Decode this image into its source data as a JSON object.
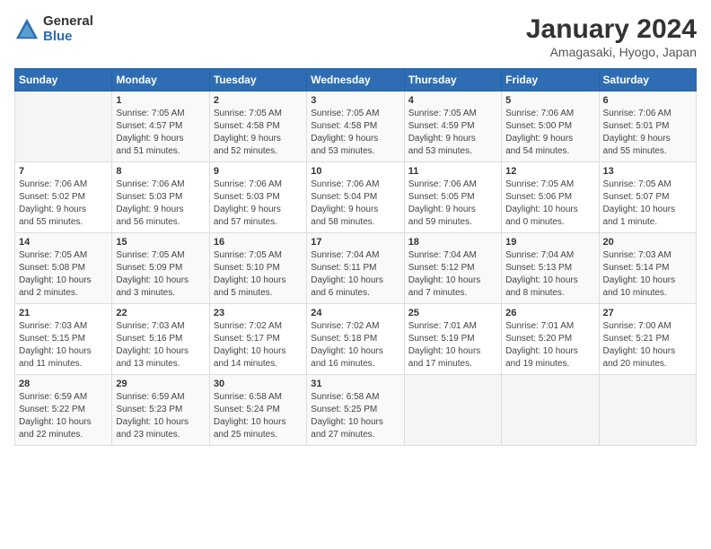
{
  "logo": {
    "general": "General",
    "blue": "Blue"
  },
  "header": {
    "title": "January 2024",
    "subtitle": "Amagasaki, Hyogo, Japan"
  },
  "columns": [
    "Sunday",
    "Monday",
    "Tuesday",
    "Wednesday",
    "Thursday",
    "Friday",
    "Saturday"
  ],
  "weeks": [
    [
      {
        "day": "",
        "info": ""
      },
      {
        "day": "1",
        "info": "Sunrise: 7:05 AM\nSunset: 4:57 PM\nDaylight: 9 hours\nand 51 minutes."
      },
      {
        "day": "2",
        "info": "Sunrise: 7:05 AM\nSunset: 4:58 PM\nDaylight: 9 hours\nand 52 minutes."
      },
      {
        "day": "3",
        "info": "Sunrise: 7:05 AM\nSunset: 4:58 PM\nDaylight: 9 hours\nand 53 minutes."
      },
      {
        "day": "4",
        "info": "Sunrise: 7:05 AM\nSunset: 4:59 PM\nDaylight: 9 hours\nand 53 minutes."
      },
      {
        "day": "5",
        "info": "Sunrise: 7:06 AM\nSunset: 5:00 PM\nDaylight: 9 hours\nand 54 minutes."
      },
      {
        "day": "6",
        "info": "Sunrise: 7:06 AM\nSunset: 5:01 PM\nDaylight: 9 hours\nand 55 minutes."
      }
    ],
    [
      {
        "day": "7",
        "info": "Sunrise: 7:06 AM\nSunset: 5:02 PM\nDaylight: 9 hours\nand 55 minutes."
      },
      {
        "day": "8",
        "info": "Sunrise: 7:06 AM\nSunset: 5:03 PM\nDaylight: 9 hours\nand 56 minutes."
      },
      {
        "day": "9",
        "info": "Sunrise: 7:06 AM\nSunset: 5:03 PM\nDaylight: 9 hours\nand 57 minutes."
      },
      {
        "day": "10",
        "info": "Sunrise: 7:06 AM\nSunset: 5:04 PM\nDaylight: 9 hours\nand 58 minutes."
      },
      {
        "day": "11",
        "info": "Sunrise: 7:06 AM\nSunset: 5:05 PM\nDaylight: 9 hours\nand 59 minutes."
      },
      {
        "day": "12",
        "info": "Sunrise: 7:05 AM\nSunset: 5:06 PM\nDaylight: 10 hours\nand 0 minutes."
      },
      {
        "day": "13",
        "info": "Sunrise: 7:05 AM\nSunset: 5:07 PM\nDaylight: 10 hours\nand 1 minute."
      }
    ],
    [
      {
        "day": "14",
        "info": "Sunrise: 7:05 AM\nSunset: 5:08 PM\nDaylight: 10 hours\nand 2 minutes."
      },
      {
        "day": "15",
        "info": "Sunrise: 7:05 AM\nSunset: 5:09 PM\nDaylight: 10 hours\nand 3 minutes."
      },
      {
        "day": "16",
        "info": "Sunrise: 7:05 AM\nSunset: 5:10 PM\nDaylight: 10 hours\nand 5 minutes."
      },
      {
        "day": "17",
        "info": "Sunrise: 7:04 AM\nSunset: 5:11 PM\nDaylight: 10 hours\nand 6 minutes."
      },
      {
        "day": "18",
        "info": "Sunrise: 7:04 AM\nSunset: 5:12 PM\nDaylight: 10 hours\nand 7 minutes."
      },
      {
        "day": "19",
        "info": "Sunrise: 7:04 AM\nSunset: 5:13 PM\nDaylight: 10 hours\nand 8 minutes."
      },
      {
        "day": "20",
        "info": "Sunrise: 7:03 AM\nSunset: 5:14 PM\nDaylight: 10 hours\nand 10 minutes."
      }
    ],
    [
      {
        "day": "21",
        "info": "Sunrise: 7:03 AM\nSunset: 5:15 PM\nDaylight: 10 hours\nand 11 minutes."
      },
      {
        "day": "22",
        "info": "Sunrise: 7:03 AM\nSunset: 5:16 PM\nDaylight: 10 hours\nand 13 minutes."
      },
      {
        "day": "23",
        "info": "Sunrise: 7:02 AM\nSunset: 5:17 PM\nDaylight: 10 hours\nand 14 minutes."
      },
      {
        "day": "24",
        "info": "Sunrise: 7:02 AM\nSunset: 5:18 PM\nDaylight: 10 hours\nand 16 minutes."
      },
      {
        "day": "25",
        "info": "Sunrise: 7:01 AM\nSunset: 5:19 PM\nDaylight: 10 hours\nand 17 minutes."
      },
      {
        "day": "26",
        "info": "Sunrise: 7:01 AM\nSunset: 5:20 PM\nDaylight: 10 hours\nand 19 minutes."
      },
      {
        "day": "27",
        "info": "Sunrise: 7:00 AM\nSunset: 5:21 PM\nDaylight: 10 hours\nand 20 minutes."
      }
    ],
    [
      {
        "day": "28",
        "info": "Sunrise: 6:59 AM\nSunset: 5:22 PM\nDaylight: 10 hours\nand 22 minutes."
      },
      {
        "day": "29",
        "info": "Sunrise: 6:59 AM\nSunset: 5:23 PM\nDaylight: 10 hours\nand 23 minutes."
      },
      {
        "day": "30",
        "info": "Sunrise: 6:58 AM\nSunset: 5:24 PM\nDaylight: 10 hours\nand 25 minutes."
      },
      {
        "day": "31",
        "info": "Sunrise: 6:58 AM\nSunset: 5:25 PM\nDaylight: 10 hours\nand 27 minutes."
      },
      {
        "day": "",
        "info": ""
      },
      {
        "day": "",
        "info": ""
      },
      {
        "day": "",
        "info": ""
      }
    ]
  ]
}
